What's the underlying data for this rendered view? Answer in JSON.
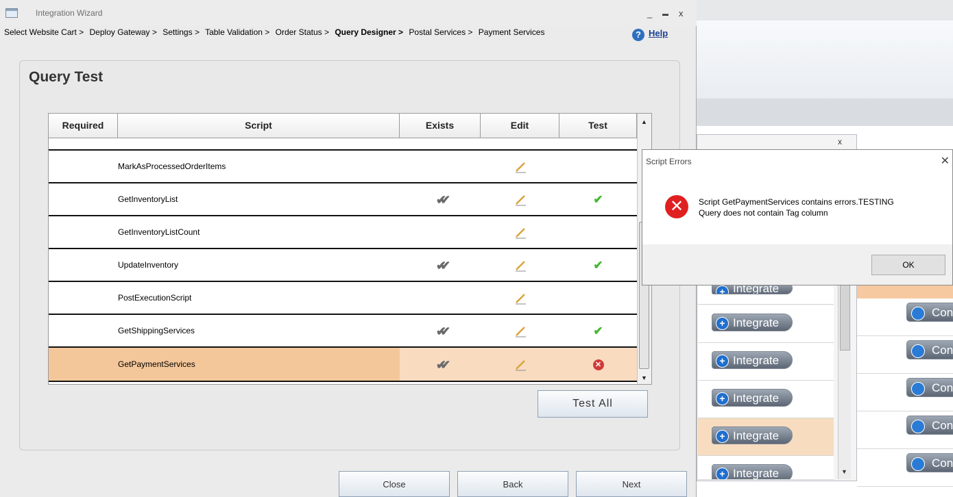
{
  "window": {
    "title": "Integration Wizard",
    "minimize": "_",
    "maximize": "▬",
    "close": "x"
  },
  "breadcrumbs": [
    "Select Website Cart >",
    "Deploy Gateway >",
    "Settings >",
    "Table Validation >",
    "Order Status >",
    "Query Designer >",
    "Postal Services >",
    "Payment Services"
  ],
  "active_crumb": "Query Designer >",
  "help": {
    "icon": "help-icon",
    "label": "Help"
  },
  "card_title": "Query Test",
  "grid": {
    "columns": [
      "Required",
      "Script",
      "Exists",
      "Edit",
      "Test"
    ],
    "rows": [
      {
        "script": "MarkAsProcessedOrderItems",
        "exists": false,
        "edit": true,
        "test": "none"
      },
      {
        "script": "GetInventoryList",
        "exists": true,
        "edit": true,
        "test": "pass"
      },
      {
        "script": "GetInventoryListCount",
        "exists": false,
        "edit": true,
        "test": "none"
      },
      {
        "script": "UpdateInventory",
        "exists": true,
        "edit": true,
        "test": "pass"
      },
      {
        "script": "PostExecutionScript",
        "exists": false,
        "edit": true,
        "test": "none"
      },
      {
        "script": "GetShippingServices",
        "exists": true,
        "edit": true,
        "test": "pass"
      },
      {
        "script": "GetPaymentServices",
        "exists": true,
        "edit": true,
        "test": "fail",
        "selected": true
      }
    ]
  },
  "buttons": {
    "test_all": "Test All",
    "close": "Close",
    "back": "Back",
    "next": "Next"
  },
  "dialog": {
    "title": "Script Errors",
    "close": "✕",
    "message_line1": "Script GetPaymentServices contains errors.TESTING",
    "message_line2": "Query does not contain Tag column",
    "ok": "OK"
  },
  "background": {
    "panel_close": "x",
    "integrate_label": "Integrate",
    "config_label": "Con"
  },
  "colors": {
    "selected_row": "#f4c79a",
    "error_red": "#e02020",
    "pass_green": "#44b830"
  }
}
